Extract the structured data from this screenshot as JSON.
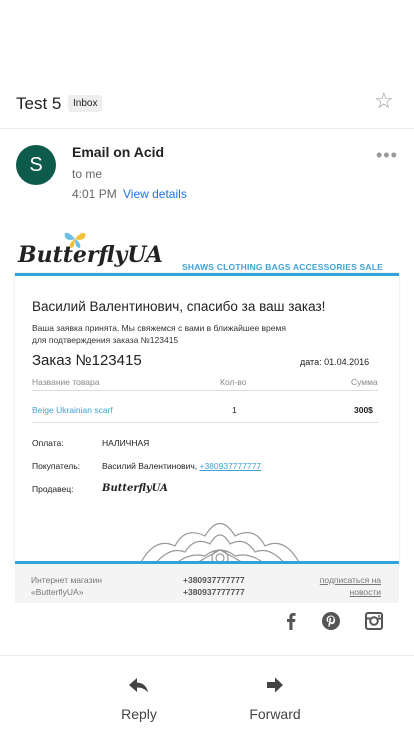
{
  "header": {
    "subject": "Test 5",
    "label": "Inbox"
  },
  "message": {
    "avatar_letter": "S",
    "sender": "Email on Acid",
    "recipient": "to me",
    "time": "4:01 PM",
    "view_details": "View details"
  },
  "email": {
    "brand": "ButterflyUA",
    "tagline": "SHAWS CLOTHING BAGS ACCESSORIES SALE",
    "greeting": "Василий Валентинович, спасибо за ваш заказ!",
    "note_line1": "Ваша заявка принята. Мы свяжемся с вами в ближайшее время",
    "note_line2": "для подтверждения заказа №123415",
    "order_title": "Заказ №123415",
    "order_date": "дата: 01.04.2016",
    "table_headers": [
      "Название товара",
      "Кол-во",
      "Сумма"
    ],
    "item": {
      "name": "Beige Ukrainian scarf",
      "qty": "1",
      "sum": "300$"
    },
    "payment_label": "Оплата:",
    "payment_value": "НАЛИЧНАЯ",
    "buyer_label": "Покупатель:",
    "buyer_name": "Василий Валентинович,",
    "buyer_phone": "+380937777777",
    "seller_label": "Продавец:",
    "seller_logo": "ButterflyUA",
    "footer_shop_line1": "Интернет магазин",
    "footer_shop_line2": "«ButterflyUA»",
    "footer_phone1": "+380937777777",
    "footer_phone2": "+380937777777",
    "footer_subscribe_line1": "подписаться на",
    "footer_subscribe_line2": "новости"
  },
  "social": [
    "facebook-icon",
    "pinterest-icon",
    "instagram-icon"
  ],
  "actions": {
    "reply": "Reply",
    "forward": "Forward"
  },
  "colors": {
    "accent": "#2fa4d8",
    "link": "#1a73e8",
    "avatar": "#0e5b4b"
  }
}
